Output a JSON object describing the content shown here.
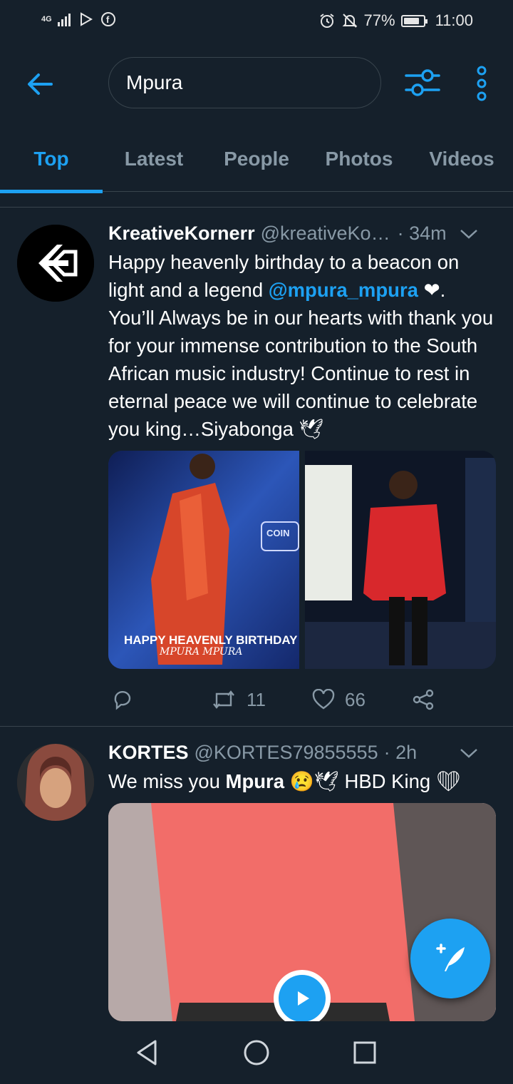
{
  "status_bar": {
    "network": "4G",
    "battery": "77%",
    "time": "11:00"
  },
  "search": {
    "query": "Mpura"
  },
  "tabs": [
    {
      "label": "Top",
      "active": true
    },
    {
      "label": "Latest",
      "active": false
    },
    {
      "label": "People",
      "active": false
    },
    {
      "label": "Photos",
      "active": false
    },
    {
      "label": "Videos",
      "active": false
    }
  ],
  "tweets": [
    {
      "name": "KreativeKornerr",
      "handle": "@kreativeKo…",
      "time": "· 34m",
      "text_part1": "Happy heavenly birthday to a beacon on light and a legend ",
      "mention": "@mpura_mpura",
      "text_part2": " ❤. You’ll Always be in our hearts with thank you for your immense contribution to the South African music industry! Continue to rest in eternal peace  we will continue to celebrate you king…Siyabonga 🕊",
      "media_caption_1": "HAPPY HEAVENLY BIRTHDAY",
      "media_caption_2": "MPURA MPURA",
      "media_sign": "COIN",
      "replies": "",
      "retweets": "11",
      "likes": "66"
    },
    {
      "name": "KORTES",
      "handle": "@KORTES79855555",
      "time": "· 2h",
      "text_part1": "We miss you ",
      "bold": "Mpura",
      "text_part2": " 😢🕊 HBD King ❤"
    }
  ],
  "colors": {
    "background": "#15202b",
    "accent": "#1da1f2",
    "secondary_text": "#8899a6",
    "heart": "#e0245e"
  }
}
